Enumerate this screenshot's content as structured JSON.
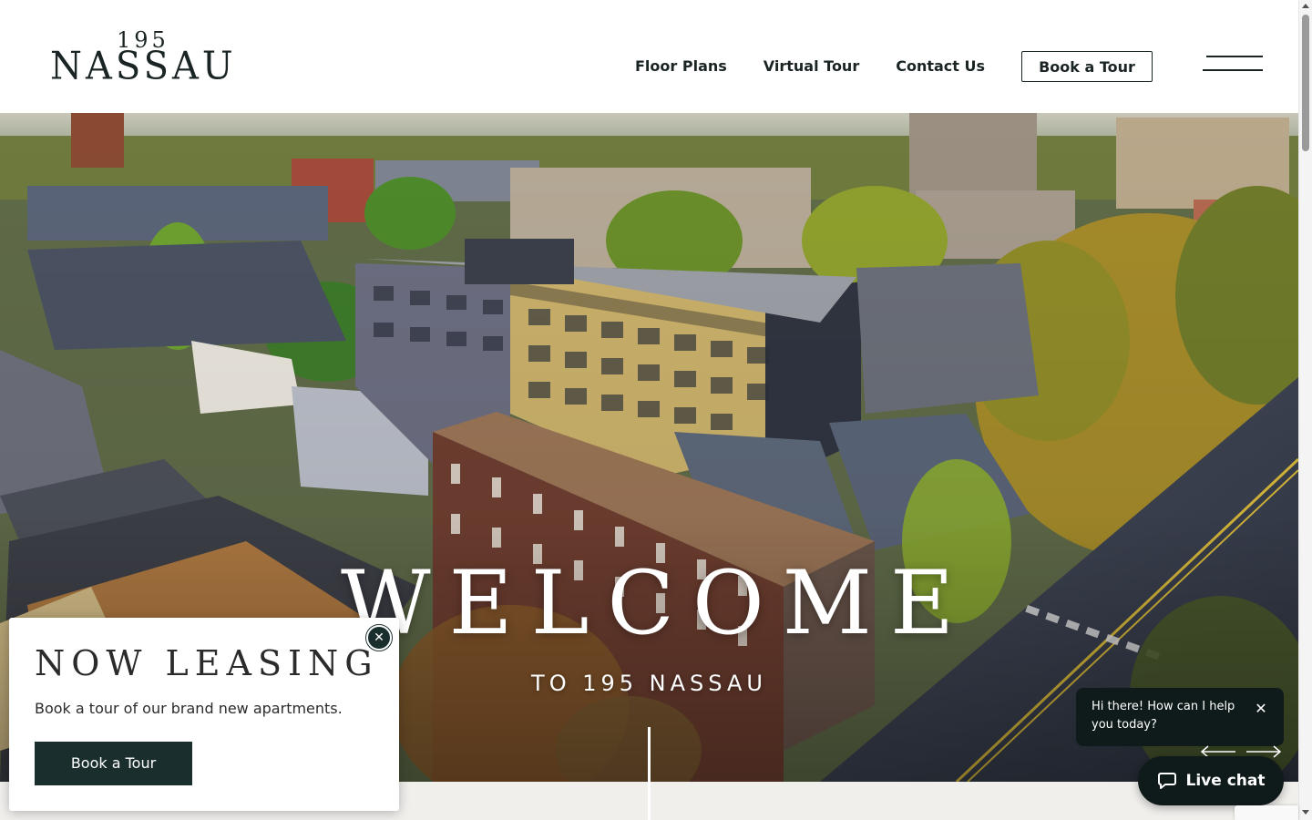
{
  "header": {
    "logo_number": "195",
    "logo_name": "NASSAU",
    "nav": {
      "floor_plans": "Floor Plans",
      "virtual_tour": "Virtual Tour",
      "contact_us": "Contact Us",
      "book_tour": "Book a Tour"
    },
    "menu_icon": "hamburger-menu-icon"
  },
  "hero": {
    "title": "WELCOME",
    "subtitle": "TO 195 NASSAU",
    "image": "aerial-town-apartment-building-photo"
  },
  "leasing_popup": {
    "title": "NOW LEASING",
    "text": "Book a tour of our brand new apartments.",
    "button": "Book a Tour",
    "close_icon": "close-icon"
  },
  "chat": {
    "greeting": "Hi there! How can I help you today?",
    "button": "Live chat",
    "icon": "chat-bubble-icon"
  },
  "colors": {
    "dark_teal": "#1a2e2e",
    "chat_dark": "#0f1a1a",
    "text_dark": "#1b2424"
  }
}
